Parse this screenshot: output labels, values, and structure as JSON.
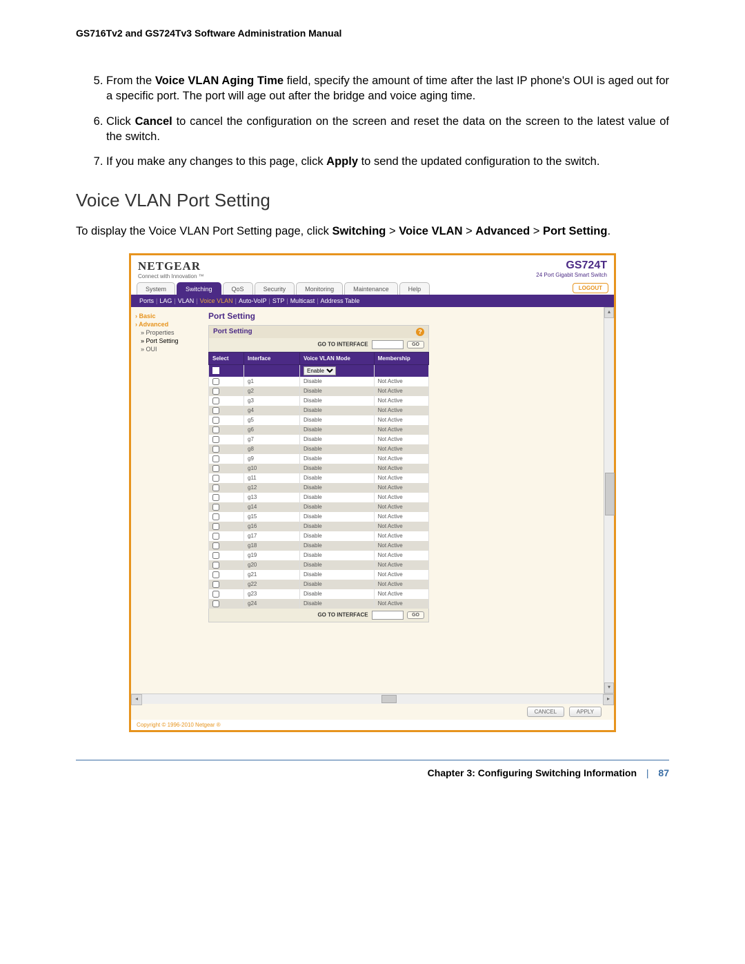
{
  "doc_header": "GS716Tv2 and GS724Tv3 Software Administration Manual",
  "steps": {
    "s5_pre": "From the ",
    "s5_b": "Voice VLAN Aging Time",
    "s5_post": " field, specify the amount of time after the last IP phone's OUI is aged out for a specific port. The port will age out after the bridge and voice aging time.",
    "s6_pre": "Click ",
    "s6_b": "Cancel",
    "s6_post": " to cancel the configuration on the screen and reset the data on the screen to the latest value of the switch.",
    "s7_pre": "If you make any changes to this page, click ",
    "s7_b": "Apply",
    "s7_post": " to send the updated configuration to the switch."
  },
  "section_title": "Voice VLAN Port Setting",
  "intro": {
    "pre": "To display the Voice VLAN Port Setting page, click ",
    "b1": "Switching",
    "gt1": " > ",
    "b2": "Voice VLAN",
    "gt2": " > ",
    "b3": "Advanced",
    "gt3": " > ",
    "b4": "Port Setting",
    "post": "."
  },
  "shot": {
    "logo": "NETGEAR",
    "logo_sub": "Connect with Innovation ™",
    "model": "GS724T",
    "model_sub": "24 Port Gigabit Smart Switch",
    "main_tabs": [
      "System",
      "Switching",
      "QoS",
      "Security",
      "Monitoring",
      "Maintenance",
      "Help"
    ],
    "main_tabs_active": 1,
    "logout": "LOGOUT",
    "sub_tabs": [
      "Ports",
      "LAG",
      "VLAN",
      "Voice VLAN",
      "Auto-VoIP",
      "STP",
      "Multicast",
      "Address Table"
    ],
    "sub_tabs_active": 3,
    "sidebar": {
      "cat1": "Basic",
      "cat2": "Advanced",
      "items": [
        "Properties",
        "Port Setting",
        "OUI"
      ],
      "items_active": 1
    },
    "panel_title": "Port Setting",
    "box_title": "Port Setting",
    "goto_label": "GO TO INTERFACE",
    "go": "GO",
    "columns": [
      "Select",
      "Interface",
      "Voice VLAN Mode",
      "Membership"
    ],
    "filter_mode": "Enable",
    "rows": [
      {
        "if": "g1",
        "mode": "Disable",
        "mem": "Not Active"
      },
      {
        "if": "g2",
        "mode": "Disable",
        "mem": "Not Active"
      },
      {
        "if": "g3",
        "mode": "Disable",
        "mem": "Not Active"
      },
      {
        "if": "g4",
        "mode": "Disable",
        "mem": "Not Active"
      },
      {
        "if": "g5",
        "mode": "Disable",
        "mem": "Not Active"
      },
      {
        "if": "g6",
        "mode": "Disable",
        "mem": "Not Active"
      },
      {
        "if": "g7",
        "mode": "Disable",
        "mem": "Not Active"
      },
      {
        "if": "g8",
        "mode": "Disable",
        "mem": "Not Active"
      },
      {
        "if": "g9",
        "mode": "Disable",
        "mem": "Not Active"
      },
      {
        "if": "g10",
        "mode": "Disable",
        "mem": "Not Active"
      },
      {
        "if": "g11",
        "mode": "Disable",
        "mem": "Not Active"
      },
      {
        "if": "g12",
        "mode": "Disable",
        "mem": "Not Active"
      },
      {
        "if": "g13",
        "mode": "Disable",
        "mem": "Not Active"
      },
      {
        "if": "g14",
        "mode": "Disable",
        "mem": "Not Active"
      },
      {
        "if": "g15",
        "mode": "Disable",
        "mem": "Not Active"
      },
      {
        "if": "g16",
        "mode": "Disable",
        "mem": "Not Active"
      },
      {
        "if": "g17",
        "mode": "Disable",
        "mem": "Not Active"
      },
      {
        "if": "g18",
        "mode": "Disable",
        "mem": "Not Active"
      },
      {
        "if": "g19",
        "mode": "Disable",
        "mem": "Not Active"
      },
      {
        "if": "g20",
        "mode": "Disable",
        "mem": "Not Active"
      },
      {
        "if": "g21",
        "mode": "Disable",
        "mem": "Not Active"
      },
      {
        "if": "g22",
        "mode": "Disable",
        "mem": "Not Active"
      },
      {
        "if": "g23",
        "mode": "Disable",
        "mem": "Not Active"
      },
      {
        "if": "g24",
        "mode": "Disable",
        "mem": "Not Active"
      }
    ],
    "cancel": "CANCEL",
    "apply": "APPLY",
    "copyright": "Copyright © 1996-2010 Netgear ®"
  },
  "footer": {
    "chapter": "Chapter 3:  Configuring Switching Information",
    "sep": "|",
    "page": "87"
  }
}
